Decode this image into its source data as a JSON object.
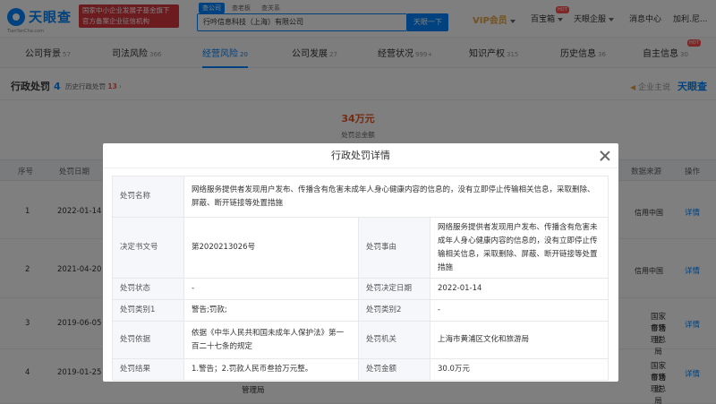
{
  "header": {
    "logo_text": "天眼查",
    "logo_sub": "TianYanCha.com",
    "gov_badge_line1": "国家中小企业发展子基金旗下",
    "gov_badge_line2": "官方备案企业征信机构",
    "search_tabs": [
      "查公司",
      "查老板",
      "查关系"
    ],
    "search_value": "行吟信息科技（上海）有限公司",
    "search_button": "天眼一下",
    "vip": "VIP会员",
    "nav_baobao": "百宝箱",
    "nav_enterprise": "天眼企服",
    "nav_messages": "消息中心",
    "nav_user": "加利.尼...",
    "hot": "HOT"
  },
  "tabs": [
    {
      "label": "公司背景",
      "count": "57"
    },
    {
      "label": "司法风险",
      "count": "366"
    },
    {
      "label": "经营风险",
      "count": "20"
    },
    {
      "label": "公司发展",
      "count": "27"
    },
    {
      "label": "经营状况",
      "count": "999+"
    },
    {
      "label": "知识产权",
      "count": "315"
    },
    {
      "label": "历史信息",
      "count": "36"
    },
    {
      "label": "自主信息",
      "count": "30"
    }
  ],
  "section": {
    "title": "行政处罚",
    "count": "4",
    "history_label": "历史行政处罚",
    "history_count": "13",
    "owner": "企业主说",
    "brand": "天眼查"
  },
  "summary": {
    "amount": "34万元",
    "label": "处罚总金额"
  },
  "bg_table": {
    "headers": {
      "index": "序号",
      "date": "处罚日期",
      "source": "数据来源",
      "action": "操作"
    },
    "rows": [
      {
        "index": "1",
        "date": "2022-01-14",
        "source": "信用中国",
        "action": "详情"
      },
      {
        "index": "2",
        "date": "2021-04-20",
        "source": "信用中国",
        "action": "详情"
      },
      {
        "index": "3",
        "date": "2019-06-05",
        "source_line1": "国家市场监",
        "source_line2": "督管理总局",
        "action": "详情"
      },
      {
        "index": "4",
        "date": "2019-01-25",
        "source_line1": "国家市场监",
        "source_line2": "督管理总局",
        "action": "详情",
        "extra": "管理局"
      }
    ]
  },
  "modal": {
    "title": "行政处罚详情",
    "labels": {
      "name": "处罚名称",
      "doc_no": "决定书文号",
      "reason": "处罚事由",
      "status": "处罚状态",
      "decision_date": "处罚决定日期",
      "category1": "处罚类别1",
      "category2": "处罚类别2",
      "basis": "处罚依据",
      "authority": "处罚机关",
      "result": "处罚结果",
      "amount": "处罚金额"
    },
    "values": {
      "name": "网络服务提供者发现用户发布、传播含有危害未成年人身心健康内容的信息的，没有立即停止传输相关信息，采取删除、屏蔽、断开链接等处置措施",
      "doc_no": "第2020213026号",
      "reason": "网络服务提供者发现用户发布、传播含有危害未成年人身心健康内容的信息的，没有立即停止传输相关信息，采取删除、屏蔽、断开链接等处置措施",
      "status": "-",
      "decision_date": "2022-01-14",
      "category1": "警告;罚款;",
      "category2": "-",
      "basis": "依据《中华人民共和国未成年人保护法》第一百二十七条的规定",
      "authority": "上海市黄浦区文化和旅游局",
      "result": "1.警告；2.罚款人民币叁拾万元整。",
      "amount": "30.0万元"
    }
  }
}
